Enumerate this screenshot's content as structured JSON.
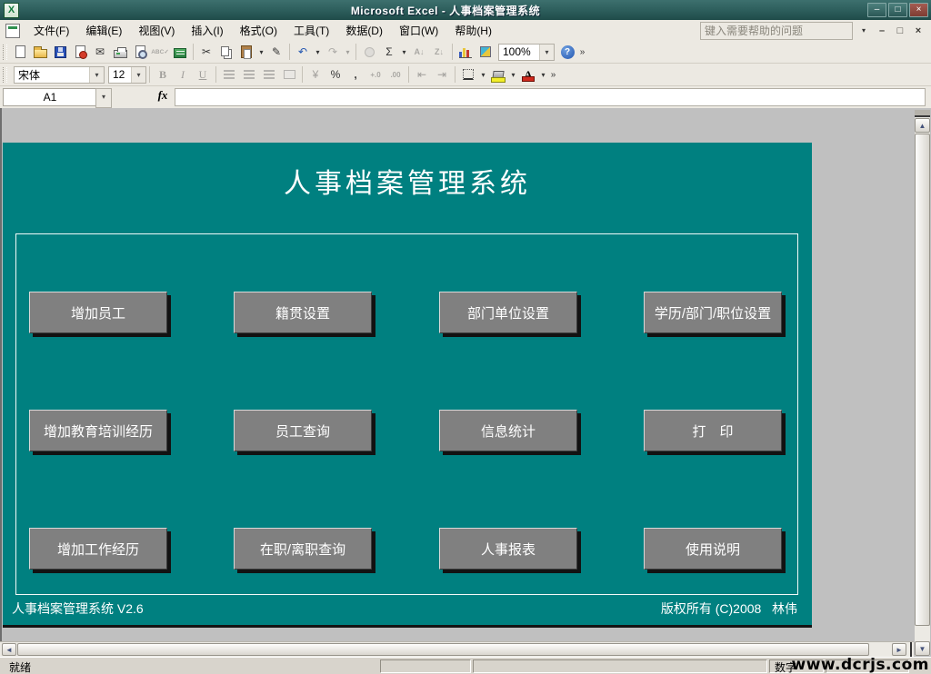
{
  "window": {
    "title": "Microsoft Excel - 人事档案管理系统",
    "app_icon_letter": "X",
    "minimize_glyph": "–",
    "maximize_glyph": "□",
    "close_glyph": "×"
  },
  "menu": {
    "items": [
      "文件(F)",
      "编辑(E)",
      "视图(V)",
      "插入(I)",
      "格式(O)",
      "工具(T)",
      "数据(D)",
      "窗口(W)",
      "帮助(H)"
    ],
    "help_placeholder": "键入需要帮助的问题",
    "help_dropdown": "▾",
    "doc_minimize": "–",
    "doc_restore": "□",
    "doc_close": "×"
  },
  "standard_toolbar": {
    "zoom_value": "100%",
    "icons": {
      "cut": "✂",
      "email": "✉",
      "spelling": "ABC✓",
      "format_painter": "✎",
      "undo": "↶",
      "redo": "↷",
      "autosum": "Σ",
      "sort_asc": "A↓",
      "sort_desc": "Z↓",
      "help": "?",
      "dropdown": "▾",
      "options": "»"
    }
  },
  "formatting_toolbar": {
    "font_name": "宋体",
    "font_size": "12",
    "bold": "B",
    "italic": "I",
    "underline": "U",
    "currency": "¥",
    "percent": "%",
    "comma": ",",
    "inc_decimal": "+.0",
    "dec_decimal": ".00",
    "dec_indent": "⇤",
    "inc_indent": "⇥",
    "font_color_letter": "A",
    "dropdown": "▾",
    "options": "»"
  },
  "formula_bar": {
    "name_box": "A1",
    "dropdown": "▾",
    "fx": "fx"
  },
  "form": {
    "title": "人事档案管理系统",
    "buttons": [
      [
        "增加员工",
        "籍贯设置",
        "部门单位设置",
        "学历/部门/职位设置"
      ],
      [
        "增加教育培训经历",
        "员工查询",
        "信息统计",
        "打　印"
      ],
      [
        "增加工作经历",
        "在职/离职查询",
        "人事报表",
        "使用说明"
      ]
    ],
    "footer_left": "人事档案管理系统 V2.6",
    "footer_right": "版权所有 (C)2008   林伟"
  },
  "scrollbars": {
    "up": "▲",
    "down": "▼",
    "left": "◄",
    "right": "►"
  },
  "status_bar": {
    "ready": "就绪",
    "num_indicator": "数字",
    "watermark": "www.dcrjs.com"
  },
  "colors": {
    "form_teal": "#008080",
    "button_gray": "#808080",
    "titlebar_teal": "#2c5d5b",
    "worksheet_gray": "#c0c0c0"
  }
}
